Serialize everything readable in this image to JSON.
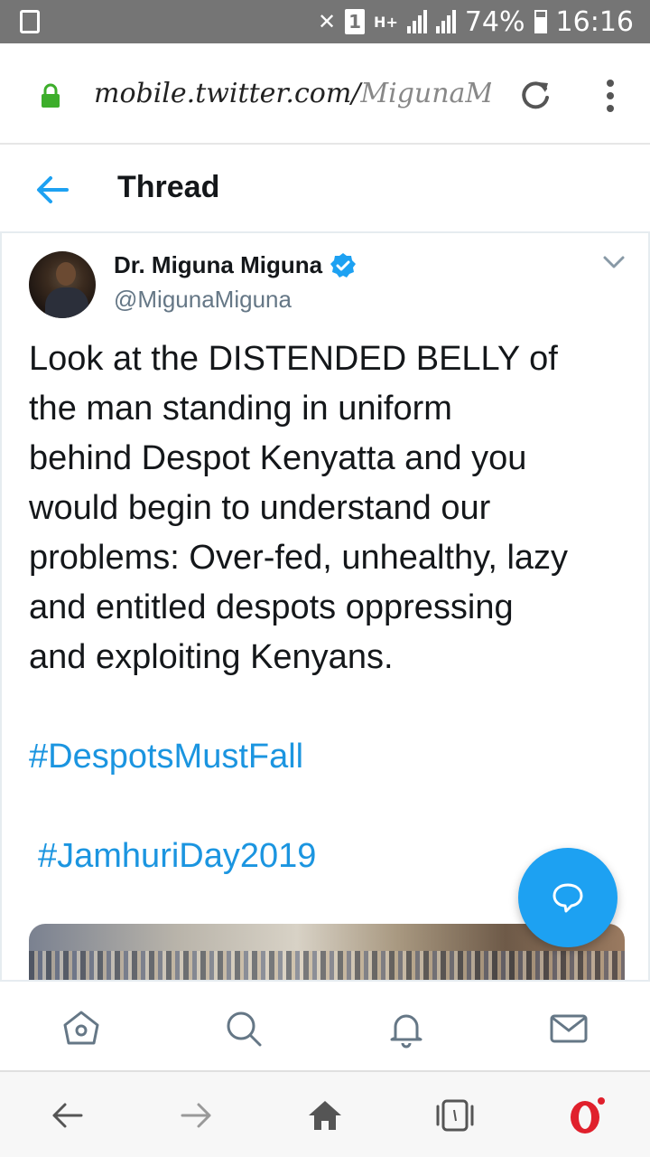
{
  "status_bar": {
    "battery": "74%",
    "time": "16:16",
    "sim_slot": "1",
    "network": "H+"
  },
  "browser": {
    "url_domain": "mobile.twitter.com/",
    "url_path": "MigunaMigi"
  },
  "header": {
    "title": "Thread"
  },
  "tweet": {
    "author_name": "Dr. Miguna Miguna",
    "author_handle": "@MigunaMiguna",
    "text": "Look at the DISTENDED BELLY of\nthe man standing in uniform\nbehind Despot Kenyatta and you\nwould begin to understand our\nproblems: Over-fed, unhealthy, lazy\nand entitled despots oppressing\nand exploiting Kenyans.",
    "hashtag_1": "#DespotsMustFall",
    "hashtag_2": "#JamhuriDay2019"
  },
  "colors": {
    "accent": "#1DA1F2",
    "link": "#1B95E0",
    "status_bar": "#757575"
  },
  "icons": {
    "tab_bar": [
      "home-icon",
      "search-icon",
      "notifications-bell-icon",
      "messages-envelope-icon"
    ],
    "nav_bar": [
      "back-arrow-icon",
      "forward-arrow-icon",
      "home-icon",
      "tabs-icon",
      "opera-icon"
    ]
  }
}
